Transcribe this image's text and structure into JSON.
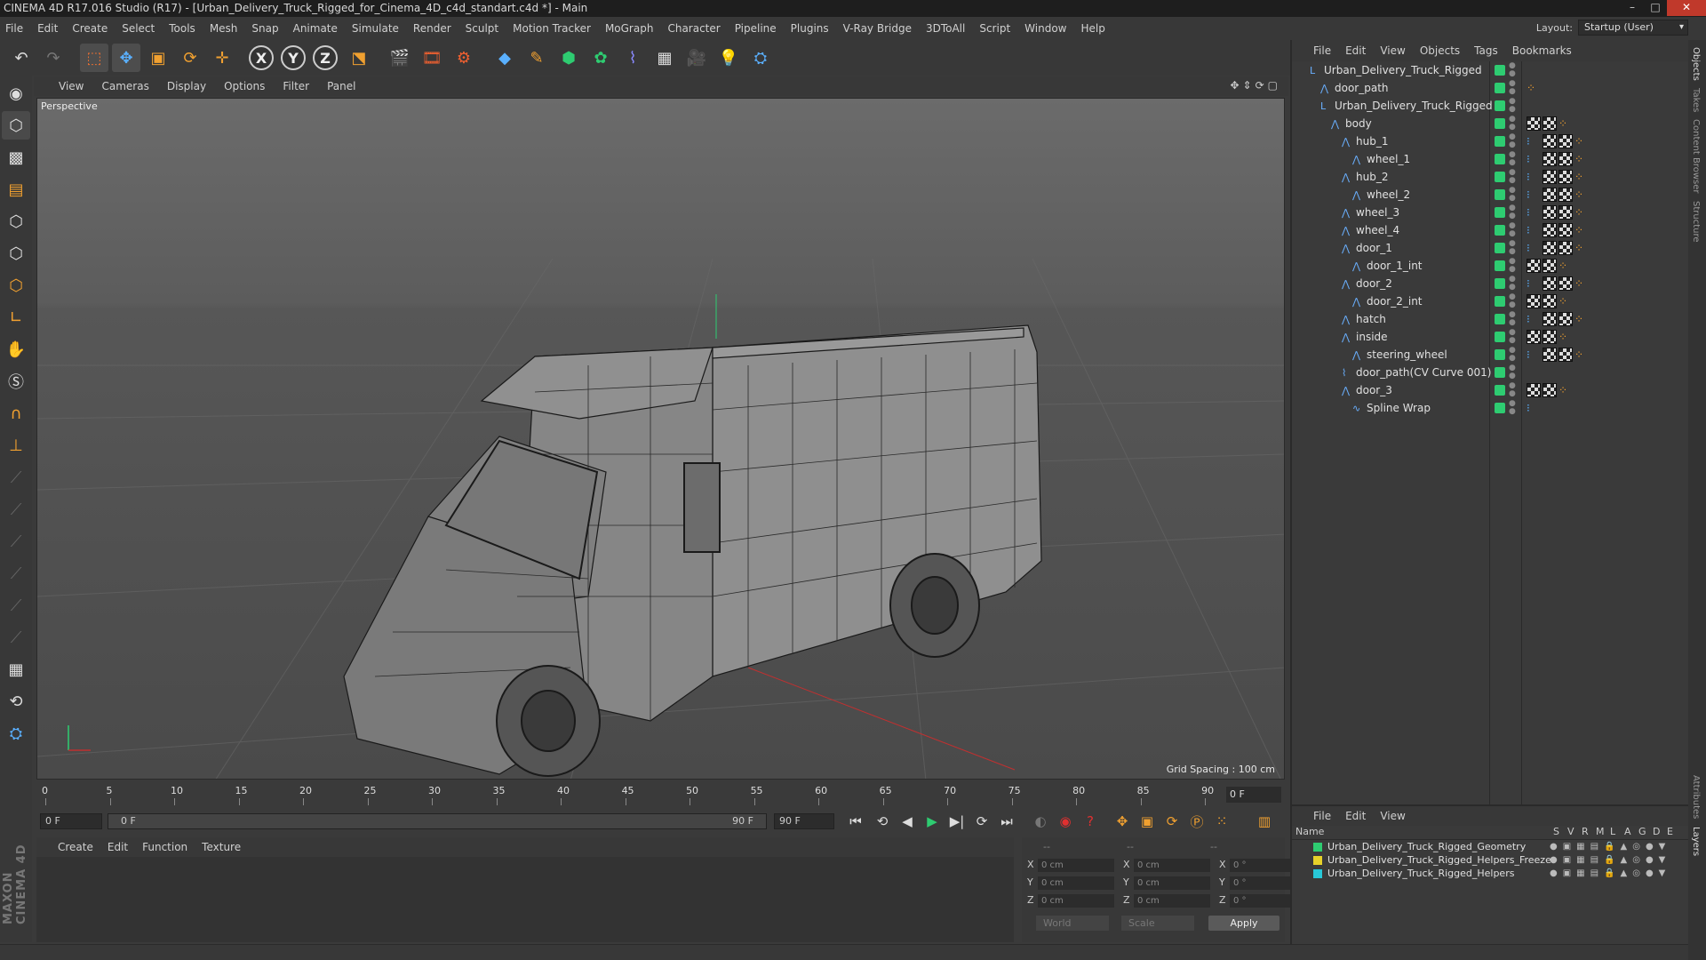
{
  "window": {
    "title": "CINEMA 4D R17.016 Studio (R17) - [Urban_Delivery_Truck_Rigged_for_Cinema_4D_c4d_standart.c4d *] - Main"
  },
  "menubar": {
    "items": [
      "File",
      "Edit",
      "Create",
      "Select",
      "Tools",
      "Mesh",
      "Snap",
      "Animate",
      "Simulate",
      "Render",
      "Sculpt",
      "Motion Tracker",
      "MoGraph",
      "Character",
      "Pipeline",
      "Plugins",
      "V-Ray Bridge",
      "3DToAll",
      "Script",
      "Window",
      "Help"
    ],
    "layout_label": "Layout:",
    "layout_value": "Startup (User)"
  },
  "viewport": {
    "menu": [
      "View",
      "Cameras",
      "Display",
      "Options",
      "Filter",
      "Panel"
    ],
    "camera_label": "Perspective",
    "grid_spacing": "Grid Spacing : 100 cm"
  },
  "timeline": {
    "ticks": [
      "0",
      "5",
      "10",
      "15",
      "20",
      "25",
      "30",
      "35",
      "40",
      "45",
      "50",
      "55",
      "60",
      "65",
      "70",
      "75",
      "80",
      "85",
      "90"
    ],
    "current_frame": "0 F"
  },
  "playback": {
    "start_field": "0 F",
    "range_start": "0 F",
    "range_end": "90 F",
    "end_field": "90 F"
  },
  "material_manager": {
    "menu": [
      "Create",
      "Edit",
      "Function",
      "Texture"
    ]
  },
  "coordinates": {
    "headers": [
      "--",
      "--",
      "--"
    ],
    "rows": [
      {
        "axis": "X",
        "pos": "0 cm",
        "size_axis": "X",
        "size": "0 cm",
        "rot_axis": "X",
        "rot": "0 °"
      },
      {
        "axis": "Y",
        "pos": "0 cm",
        "size_axis": "Y",
        "size": "0 cm",
        "rot_axis": "Y",
        "rot": "0 °"
      },
      {
        "axis": "Z",
        "pos": "0 cm",
        "size_axis": "Z",
        "size": "0 cm",
        "rot_axis": "Z",
        "rot": "0 °"
      }
    ],
    "space": "World",
    "mode": "Scale",
    "apply": "Apply"
  },
  "object_manager": {
    "menu": [
      "File",
      "Edit",
      "View",
      "Objects",
      "Tags",
      "Bookmarks"
    ],
    "objects": [
      {
        "name": "Urban_Delivery_Truck_Rigged",
        "icon": "null-icon",
        "tags": []
      },
      {
        "name": "door_path",
        "icon": "joint-icon",
        "tags": [
          "dots"
        ]
      },
      {
        "name": "Urban_Delivery_Truck_Rigged",
        "icon": "null-icon",
        "tags": []
      },
      {
        "name": "body",
        "icon": "joint-icon",
        "tags": [
          "mat",
          "check",
          "dots"
        ]
      },
      {
        "name": "hub_1",
        "icon": "joint-icon",
        "tags": [
          "dot",
          "mat",
          "check",
          "dots"
        ]
      },
      {
        "name": "wheel_1",
        "icon": "joint-icon",
        "tags": [
          "dot",
          "mat",
          "check",
          "dots"
        ]
      },
      {
        "name": "hub_2",
        "icon": "joint-icon",
        "tags": [
          "dot",
          "mat",
          "check",
          "dots"
        ]
      },
      {
        "name": "wheel_2",
        "icon": "joint-icon",
        "tags": [
          "dot",
          "mat",
          "check",
          "dots"
        ]
      },
      {
        "name": "wheel_3",
        "icon": "joint-icon",
        "tags": [
          "dot",
          "mat",
          "check",
          "dots"
        ]
      },
      {
        "name": "wheel_4",
        "icon": "joint-icon",
        "tags": [
          "dot",
          "mat",
          "check",
          "dots"
        ]
      },
      {
        "name": "door_1",
        "icon": "joint-icon",
        "tags": [
          "dot",
          "mat",
          "check",
          "dots"
        ]
      },
      {
        "name": "door_1_int",
        "icon": "joint-icon",
        "tags": [
          "mat",
          "check",
          "dots"
        ]
      },
      {
        "name": "door_2",
        "icon": "joint-icon",
        "tags": [
          "dot",
          "mat",
          "check",
          "dots"
        ]
      },
      {
        "name": "door_2_int",
        "icon": "joint-icon",
        "tags": [
          "mat",
          "check",
          "dots"
        ]
      },
      {
        "name": "hatch",
        "icon": "joint-icon",
        "tags": [
          "dot",
          "mat",
          "check",
          "dots"
        ]
      },
      {
        "name": "inside",
        "icon": "joint-icon",
        "tags": [
          "mat",
          "check",
          "dots"
        ]
      },
      {
        "name": "steering_wheel",
        "icon": "joint-icon",
        "tags": [
          "dot",
          "mat",
          "check",
          "dots"
        ]
      },
      {
        "name": "door_path(CV Curve 001)",
        "icon": "spline-icon",
        "tags": []
      },
      {
        "name": "door_3",
        "icon": "joint-icon",
        "tags": [
          "mat",
          "check",
          "dots"
        ]
      },
      {
        "name": "Spline Wrap",
        "icon": "deformer-icon",
        "tags": [
          "dot"
        ]
      }
    ]
  },
  "layers": {
    "menu": [
      "File",
      "Edit",
      "View"
    ],
    "header_name": "Name",
    "header_cols": [
      "S",
      "V",
      "R",
      "M",
      "L",
      "A",
      "G",
      "D",
      "E"
    ],
    "rows": [
      {
        "name": "Urban_Delivery_Truck_Rigged_Geometry",
        "color": "#2ecc71"
      },
      {
        "name": "Urban_Delivery_Truck_Rigged_Helpers_Freeze",
        "color": "#e6d12a"
      },
      {
        "name": "Urban_Delivery_Truck_Rigged_Helpers",
        "color": "#28c8d8"
      }
    ]
  },
  "side_tabs": [
    "Objects",
    "Takes",
    "Content Browser",
    "Structure",
    "Attributes",
    "Layers"
  ],
  "colors": {
    "accent": "#f0a030",
    "visible_green": "#2ecc71",
    "axis_red": "#c03030"
  },
  "branding": {
    "logo": "MAXON CINEMA 4D"
  }
}
